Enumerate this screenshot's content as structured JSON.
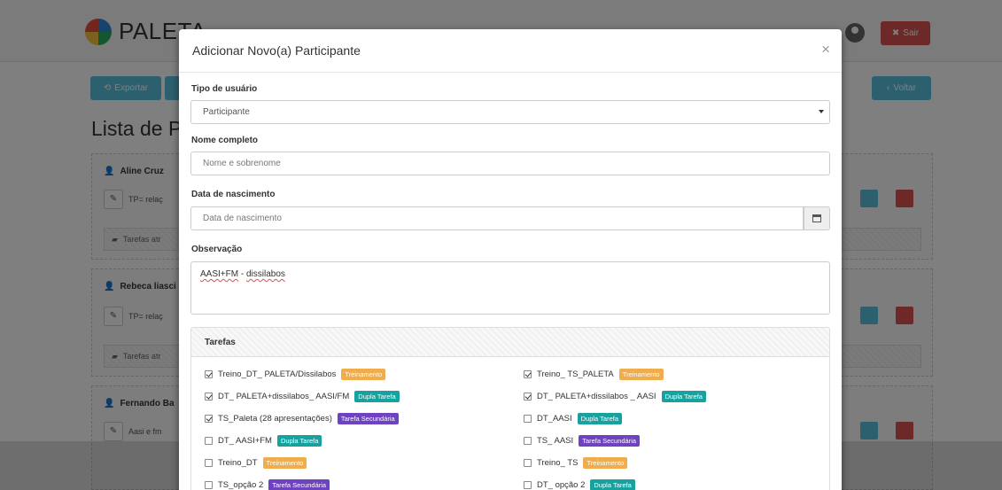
{
  "app": {
    "logo_text": "PALETA"
  },
  "header": {
    "logout_label": "Sair"
  },
  "toolbar": {
    "export_label": "Exportar",
    "back_label": "Voltar"
  },
  "page": {
    "title": "Lista de P"
  },
  "cards": [
    {
      "name": "Aline Cruz",
      "note": "TP= relaç",
      "tasks": "Tarefas atr"
    },
    {
      "name": "Rebeca liasci",
      "note": "TP= relaç",
      "tasks": "Tarefas atr"
    },
    {
      "name": "Fernando Ba",
      "note": "Aasi e fm"
    }
  ],
  "modal": {
    "title": "Adicionar Novo(a) Participante",
    "close": "×",
    "user_type_label": "Tipo de usuário",
    "user_type_value": "Participante",
    "name_label": "Nome completo",
    "name_placeholder": "Nome e sobrenome",
    "birth_label": "Data de nascimento",
    "birth_placeholder": "Data de nascimento",
    "obs_label": "Observação",
    "obs_value_a": "AASI+FM",
    "obs_value_sep": " - ",
    "obs_value_b": "dissilabos",
    "tasks_title": "Tarefas"
  },
  "badges": {
    "treino": "Treinamento",
    "dupla": "Dupla Tarefa",
    "sec": "Tarefa Secundária"
  },
  "tasks_left": [
    {
      "label": "Treino_DT_ PALETA/Dissilabos",
      "checked": true,
      "badge": "treino"
    },
    {
      "label": "DT_ PALETA+dissilabos_ AASI/FM",
      "checked": true,
      "badge": "dupla"
    },
    {
      "label": "TS_Paleta (28 apresentações)",
      "checked": true,
      "badge": "sec"
    },
    {
      "label": "DT_ AASI+FM",
      "checked": false,
      "badge": "dupla"
    },
    {
      "label": "Treino_DT",
      "checked": false,
      "badge": "treino"
    },
    {
      "label": "TS_opção 2",
      "checked": false,
      "badge": "sec"
    }
  ],
  "tasks_right": [
    {
      "label": "Treino_ TS_PALETA",
      "checked": true,
      "badge": "treino"
    },
    {
      "label": "DT_ PALETA+dissilabos _ AASI",
      "checked": true,
      "badge": "dupla"
    },
    {
      "label": "DT_AASI",
      "checked": false,
      "badge": "dupla"
    },
    {
      "label": "TS_ AASI",
      "checked": false,
      "badge": "sec"
    },
    {
      "label": "Treino_ TS",
      "checked": false,
      "badge": "treino"
    },
    {
      "label": "DT_ opção 2",
      "checked": false,
      "badge": "dupla"
    }
  ],
  "colors": {
    "info": "#5bc0de",
    "danger": "#d9534f",
    "treino": "#f0ad4e",
    "dupla": "#17a2a0",
    "sec": "#6f42c1"
  }
}
